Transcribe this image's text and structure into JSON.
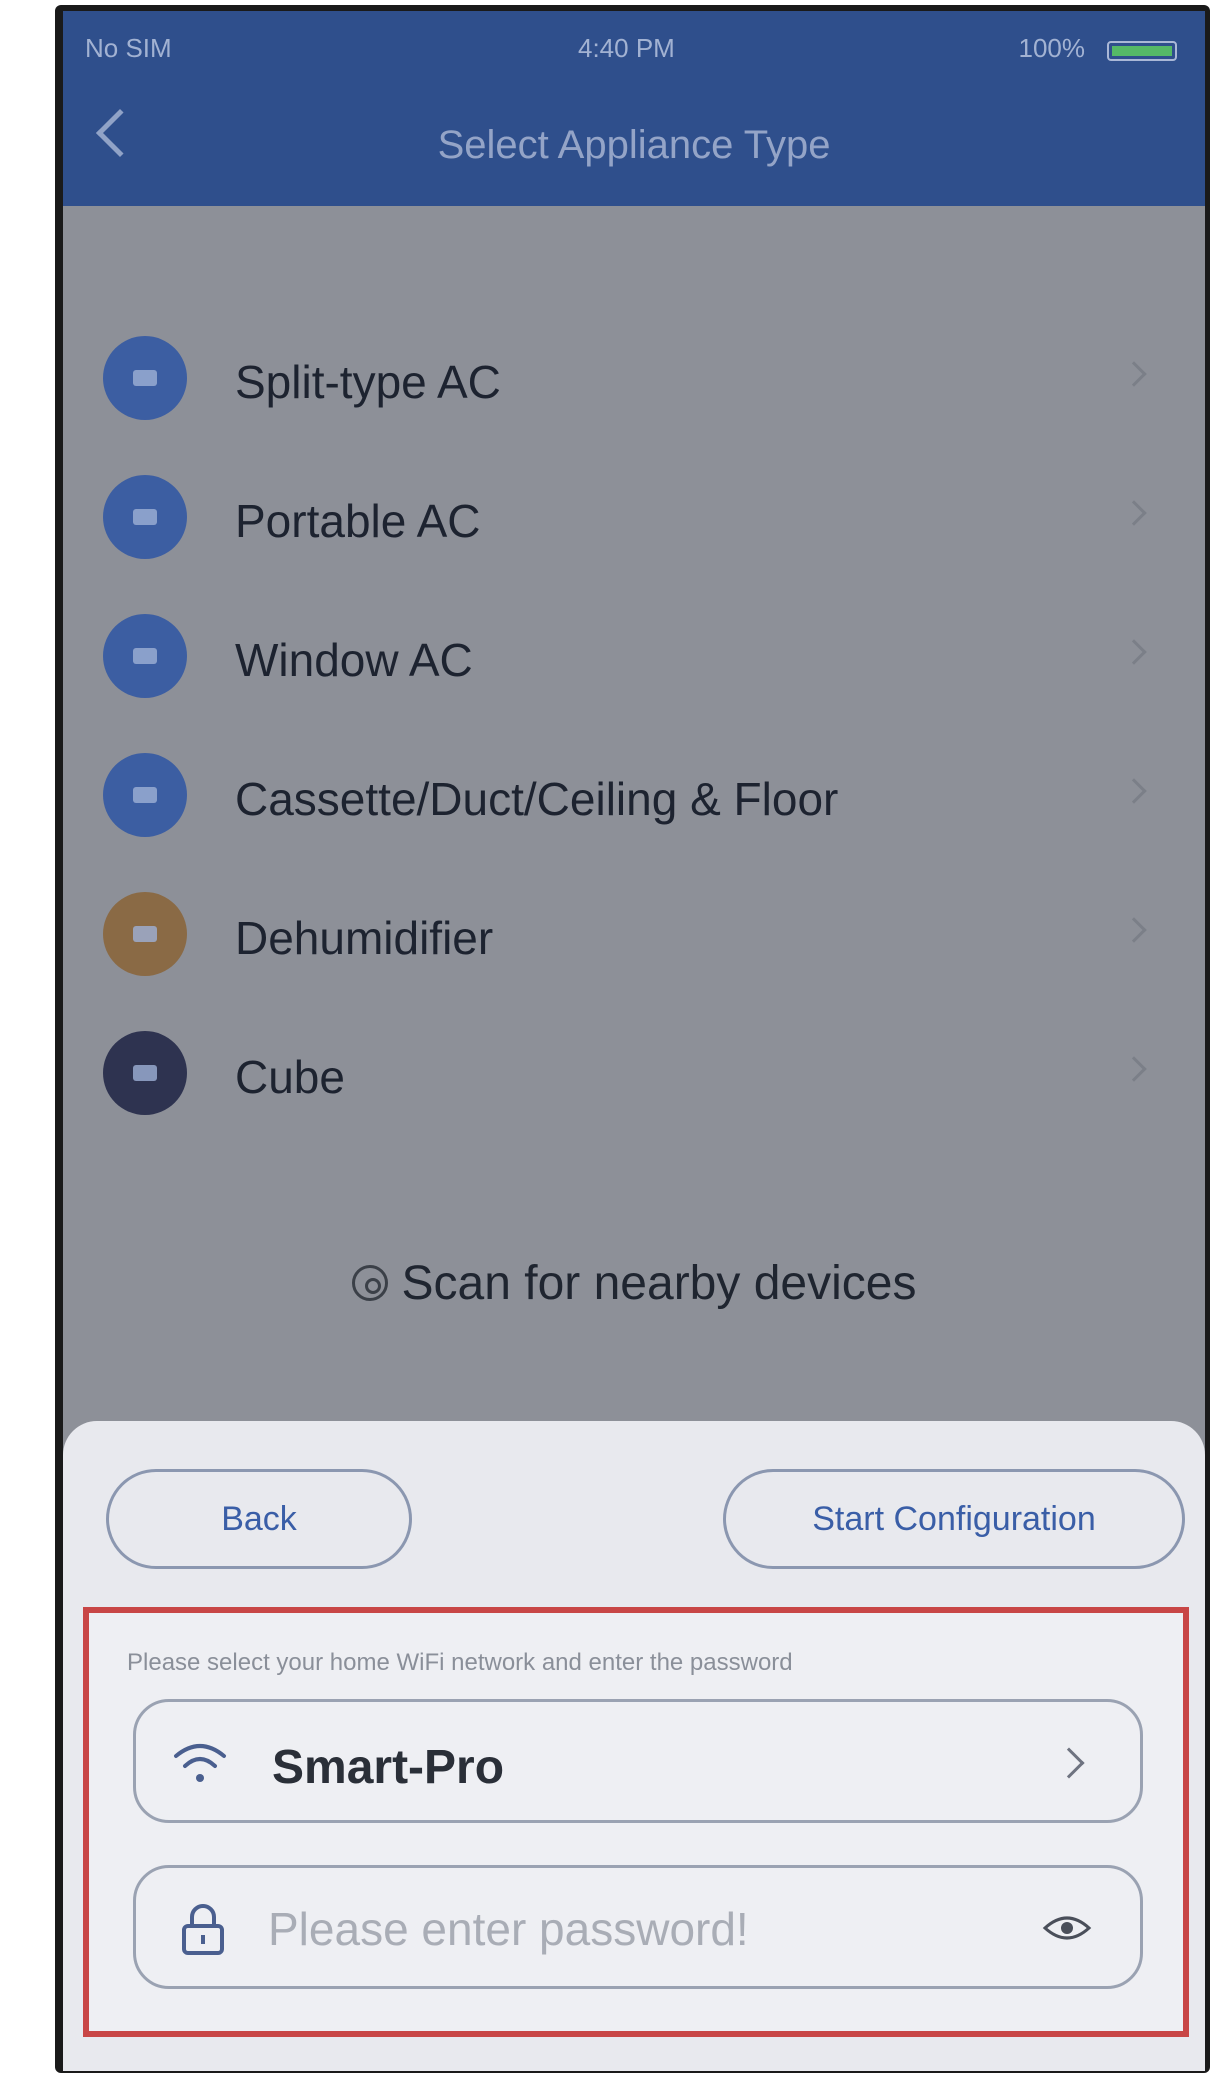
{
  "status_bar": {
    "carrier": "No SIM",
    "time": "4:40 PM",
    "battery": "100%"
  },
  "header": {
    "title": "Select Appliance Type"
  },
  "appliances": [
    {
      "label": "Split-type AC",
      "icon": "split-ac-icon",
      "icon_color": "#3c5ea2"
    },
    {
      "label": "Portable AC",
      "icon": "portable-ac-icon",
      "icon_color": "#3c5ea2"
    },
    {
      "label": "Window AC",
      "icon": "window-ac-icon",
      "icon_color": "#3c5ea2"
    },
    {
      "label": "Cassette/Duct/Ceiling & Floor",
      "icon": "cassette-ac-icon",
      "icon_color": "#3c5ea2"
    },
    {
      "label": "Dehumidifier",
      "icon": "dehumidifier-icon",
      "icon_color": "#8a6a45"
    },
    {
      "label": "Cube",
      "icon": "cube-icon",
      "icon_color": "#2e3350"
    }
  ],
  "scan": {
    "label": "Scan for nearby devices"
  },
  "sheet": {
    "back_label": "Back",
    "start_label": "Start Configuration",
    "instruction": "Please select your home WiFi network and enter the password",
    "network_name": "Smart-Pro",
    "password_placeholder": "Please enter password!"
  },
  "colors": {
    "header": "#2f4f8c",
    "accent": "#3a5ea7",
    "highlight_border": "#c84646"
  }
}
